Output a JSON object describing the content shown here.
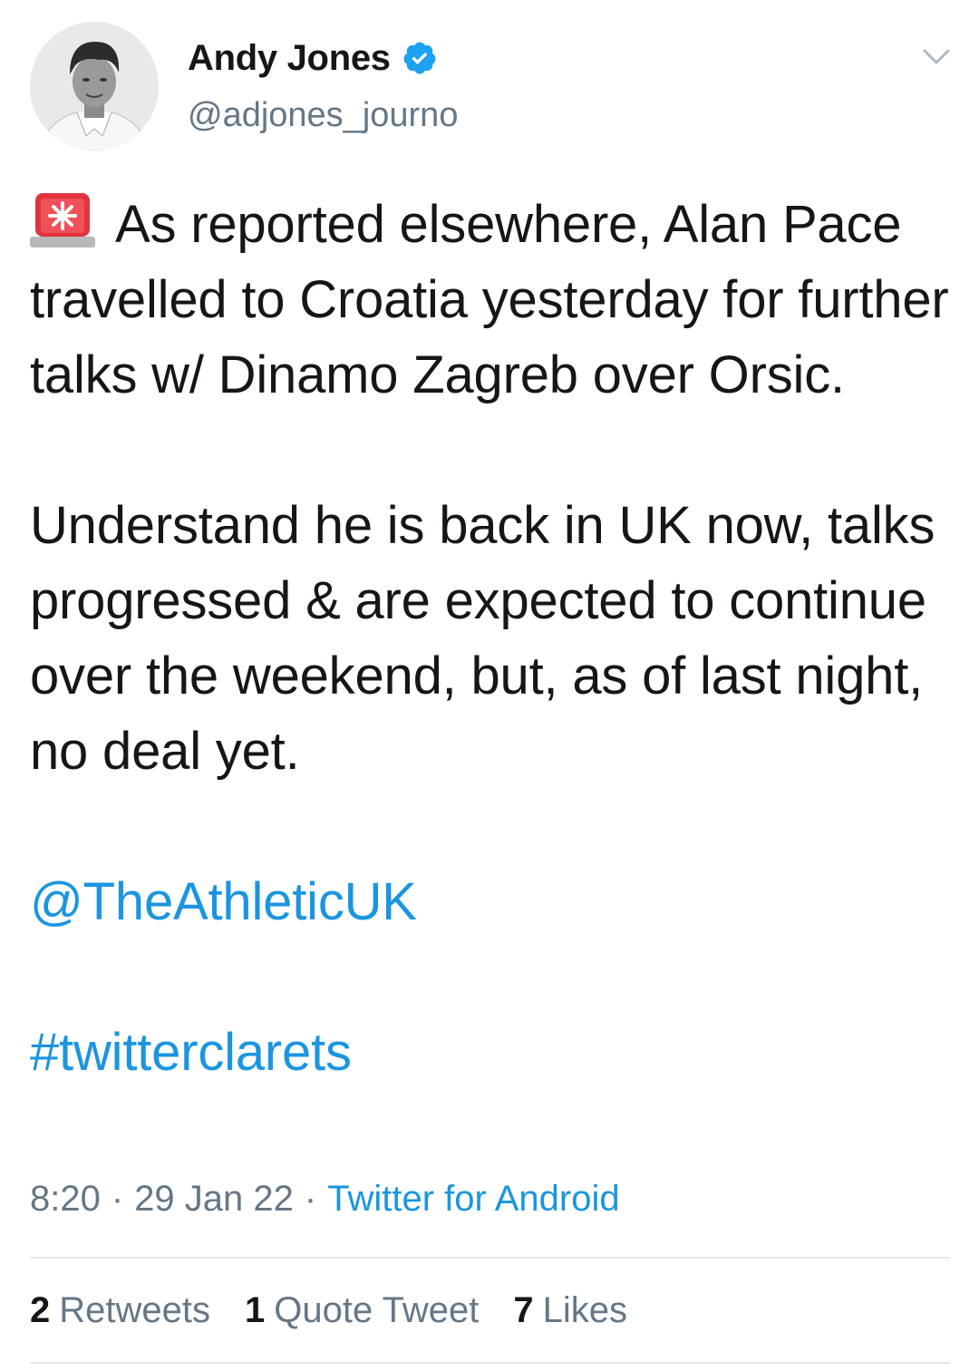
{
  "author": {
    "display_name": "Andy Jones",
    "handle": "@adjones_journo",
    "verified": true,
    "avatar_icon": "profile-photo"
  },
  "tweet": {
    "emoji_icon": "police-car-light-emoji",
    "paragraph1": "As reported elsewhere, Alan Pace travelled to Croatia yesterday for further talks w/ Dinamo Zagreb over Orsic.",
    "paragraph2": "Understand he is back in UK now, talks progressed & are expected to continue over the weekend, but, as of last night, no deal yet.",
    "mention": "@TheAthleticUK",
    "hashtag": "#twitterclarets"
  },
  "meta": {
    "time": "8:20",
    "separator": "·",
    "date": "29 Jan 22",
    "source": "Twitter for Android"
  },
  "stats": {
    "retweets_count": "2",
    "retweets_label": "Retweets",
    "quotes_count": "1",
    "quotes_label": "Quote Tweet",
    "likes_count": "7",
    "likes_label": "Likes"
  },
  "colors": {
    "link": "#1b95e0",
    "secondary_text": "#657786",
    "primary_text": "#14171a",
    "divider": "#e1e8ed"
  }
}
